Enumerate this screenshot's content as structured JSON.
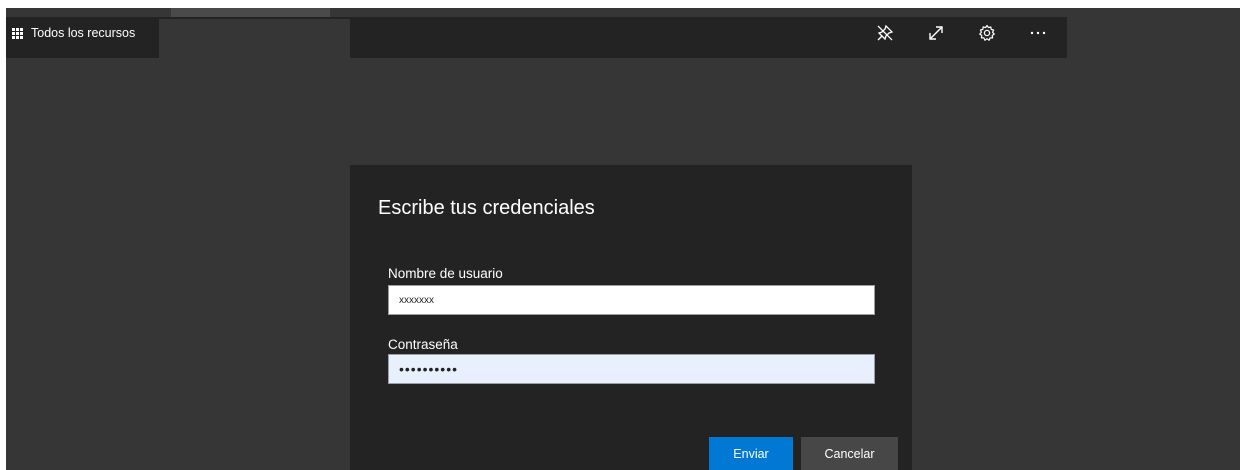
{
  "header": {
    "all_resources_label": "Todos los recursos",
    "all_resources_icon": "grid-icon",
    "toolbar": [
      {
        "icon": "unpin-icon",
        "label": "Desanclar"
      },
      {
        "icon": "expand-icon",
        "label": "Expandir"
      },
      {
        "icon": "gear-icon",
        "label": "Configuración"
      },
      {
        "icon": "more-icon",
        "label": "Más"
      }
    ]
  },
  "dialog": {
    "title": "Escribe tus credenciales",
    "username_label": "Nombre de usuario",
    "username_value": "xxxxxxx",
    "password_label": "Contraseña",
    "password_value": "••••••••••",
    "submit_label": "Enviar",
    "cancel_label": "Cancelar"
  },
  "colors": {
    "background": "#363636",
    "topbar": "#232323",
    "dialog": "#232323",
    "primary_button": "#0078d4",
    "secondary_button": "#474747",
    "password_field": "#e8f0fe"
  }
}
